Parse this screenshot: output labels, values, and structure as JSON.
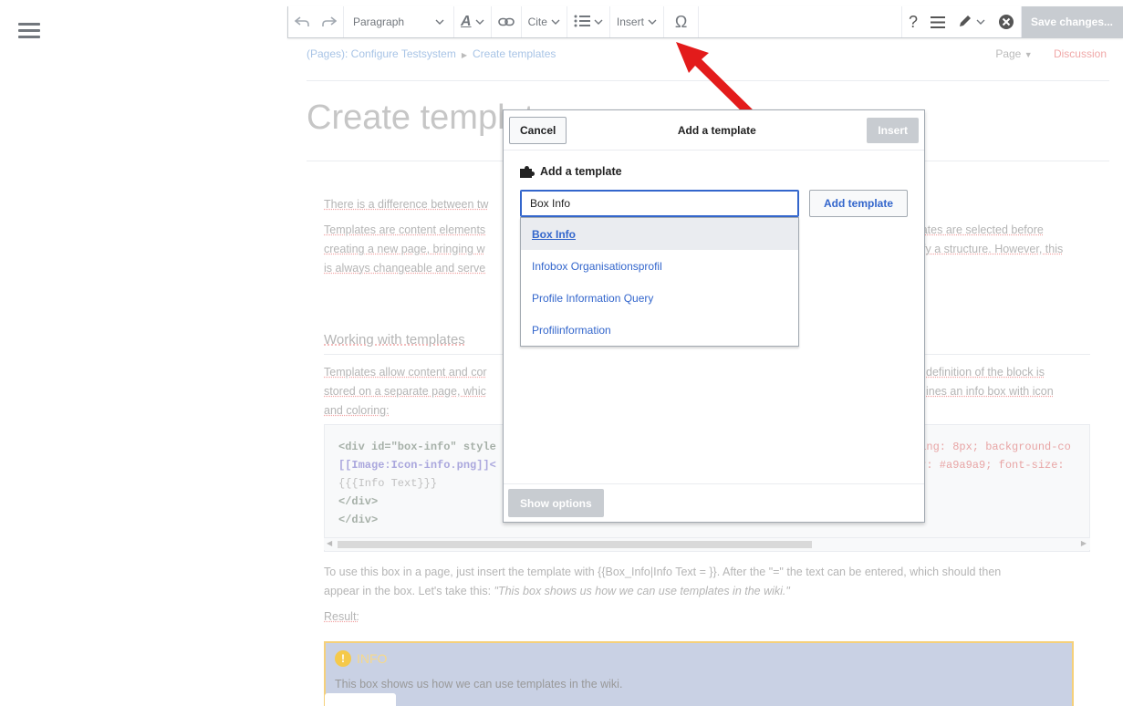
{
  "toolbar": {
    "paragraph": "Paragraph",
    "cite": "Cite",
    "insert": "Insert",
    "save": "Save changes..."
  },
  "breadcrumb": {
    "parent": "(Pages): Configure Testsystem",
    "current": "Create templates"
  },
  "page_actions": {
    "page": "Page",
    "discussion": "Discussion"
  },
  "page": {
    "title": "Create templates",
    "intro": "There is a difference between tw",
    "p1_left_1": "Templates are content elements",
    "p1_right_1": "plates are selected before",
    "p1_left_2": "creating a new page, bringing w",
    "p1_right_2": "fy a structure. However, this",
    "p1_left_3": "is always changeable and serve",
    "heading": "Working with templates",
    "p2_left_1": "Templates allow content and cor",
    "p2_right_1": "definition of the block is",
    "p2_left_2": "stored on a separate page, whic",
    "p2_right_2": "ines an info box with icon",
    "p2_left_3": "and coloring:",
    "code_line1_left": "<div id=\"box-info\" style",
    "code_line1_right": "ding: 8px; background-co",
    "code_line2_left": "[[Image:Icon-info.png]]<",
    "code_line2_right": "or: #a9a9a9; font-size:",
    "code_line3": "{{{Info Text}}}",
    "code_line4": "</div>",
    "code_line5": "</div>",
    "usage_1": "To use this box in a page, just insert the template with  {{Box_Info|Info Text = }}. After the \"=\" the text can be entered, which should then",
    "usage_2_a": "appear in the box. Let's take this: ",
    "usage_2_b": "\"This box shows us how we can use templates in the wiki.\"",
    "result": "Result:",
    "info_head": "INFO",
    "info_text": "This box shows us how we can use templates in the wiki."
  },
  "dialog": {
    "cancel": "Cancel",
    "title": "Add a template",
    "insert": "Insert",
    "section_label": "Add a template",
    "search_value": "Box Info",
    "add_button": "Add template",
    "suggestions": [
      "Box Info",
      "Infobox Organisationsprofil",
      "Profile Information Query",
      "Profilinformation"
    ],
    "show_options": "Show options"
  },
  "colors": {
    "link": "#3366cc",
    "accent_arrow": "#e60000",
    "disabled": "#c8ccd1"
  }
}
